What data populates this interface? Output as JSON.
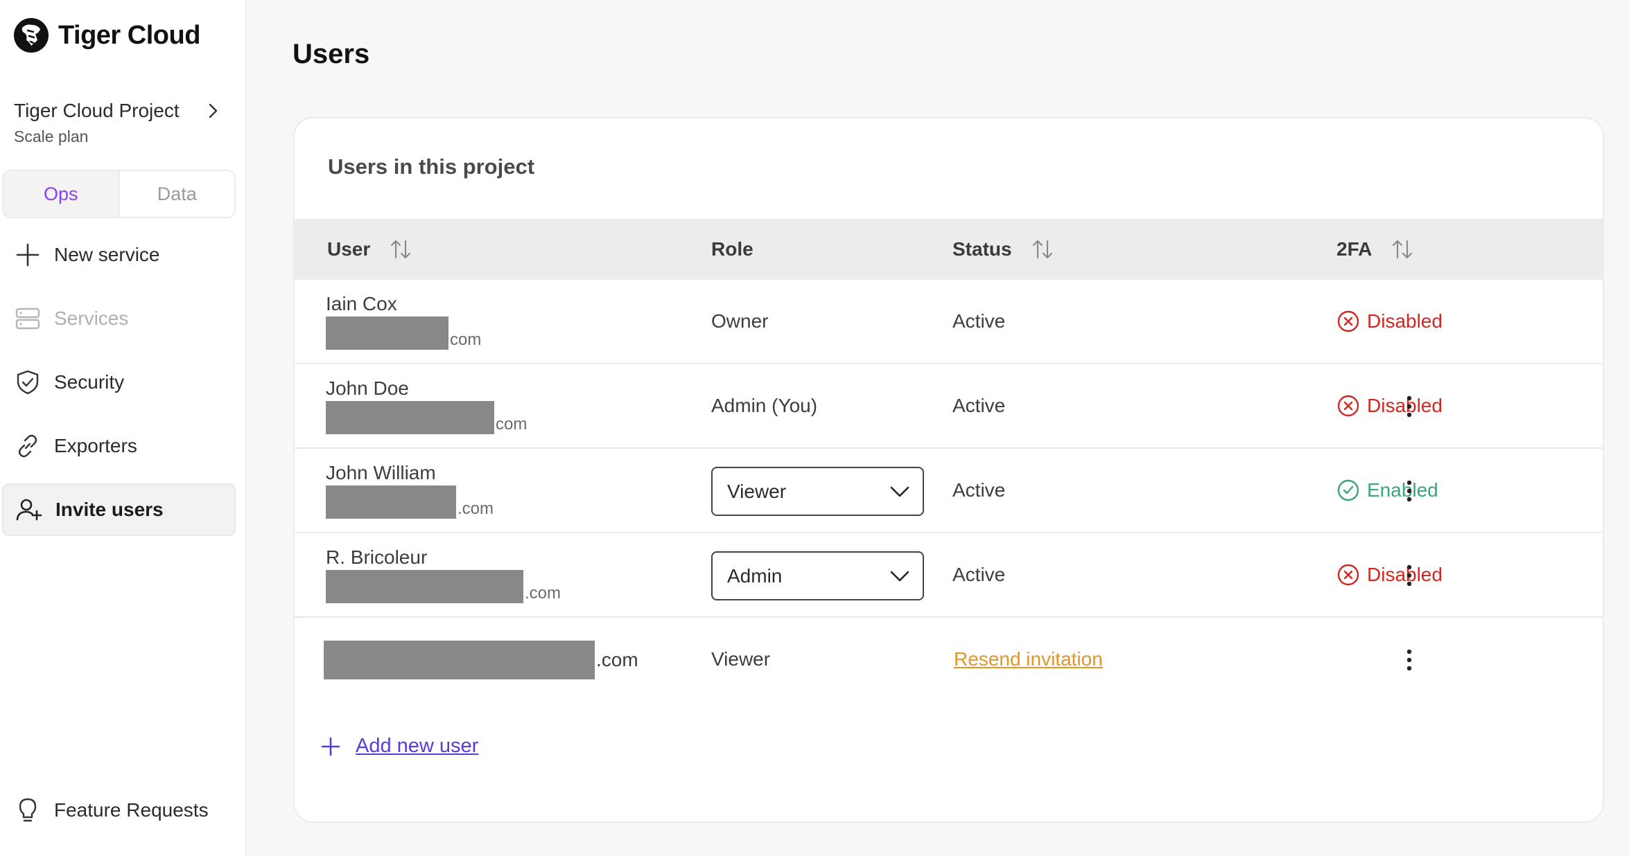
{
  "app": {
    "name": "Tiger Cloud"
  },
  "project": {
    "name": "Tiger Cloud Project",
    "plan": "Scale plan"
  },
  "mode_toggle": {
    "options": [
      "Ops",
      "Data"
    ],
    "selected": "Ops"
  },
  "sidebar": {
    "items": [
      {
        "label": "New service",
        "icon": "plus-icon",
        "state": "normal"
      },
      {
        "label": "Services",
        "icon": "services-icon",
        "state": "disabled"
      },
      {
        "label": "Security",
        "icon": "shield-icon",
        "state": "normal"
      },
      {
        "label": "Exporters",
        "icon": "link-icon",
        "state": "normal"
      },
      {
        "label": "Invite users",
        "icon": "user-plus-icon",
        "state": "active"
      }
    ],
    "footer": {
      "label": "Feature Requests",
      "icon": "lightbulb-icon"
    }
  },
  "page": {
    "title": "Users"
  },
  "users_card": {
    "title": "Users in this project",
    "columns": [
      "User",
      "Role",
      "Status",
      "2FA"
    ],
    "rows": [
      {
        "name": "Iain Cox",
        "email_suffix": "com",
        "role": "Owner",
        "role_editable": false,
        "status": "Active",
        "twofa": "Disabled"
      },
      {
        "name": "John Doe",
        "email_suffix": "com",
        "role": "Admin (You)",
        "role_editable": false,
        "status": "Active",
        "twofa": "Disabled"
      },
      {
        "name": "John William",
        "email_suffix": ".com",
        "role": "Viewer",
        "role_editable": true,
        "status": "Active",
        "twofa": "Enabled"
      },
      {
        "name": "R. Bricoleur",
        "email_suffix": ".com",
        "role": "Admin",
        "role_editable": true,
        "status": "Active",
        "twofa": "Disabled"
      },
      {
        "name": "",
        "email_suffix": ".com",
        "role": "Viewer",
        "role_editable": false,
        "status": "Resend invitation",
        "twofa": ""
      }
    ],
    "add_user_label": "Add new user"
  },
  "colors": {
    "accent_purple": "#8a3ffc",
    "link_purple": "#5b3bd6",
    "disabled_red": "#d1271f",
    "enabled_green": "#3aa57a",
    "resend_orange": "#e0962b"
  }
}
